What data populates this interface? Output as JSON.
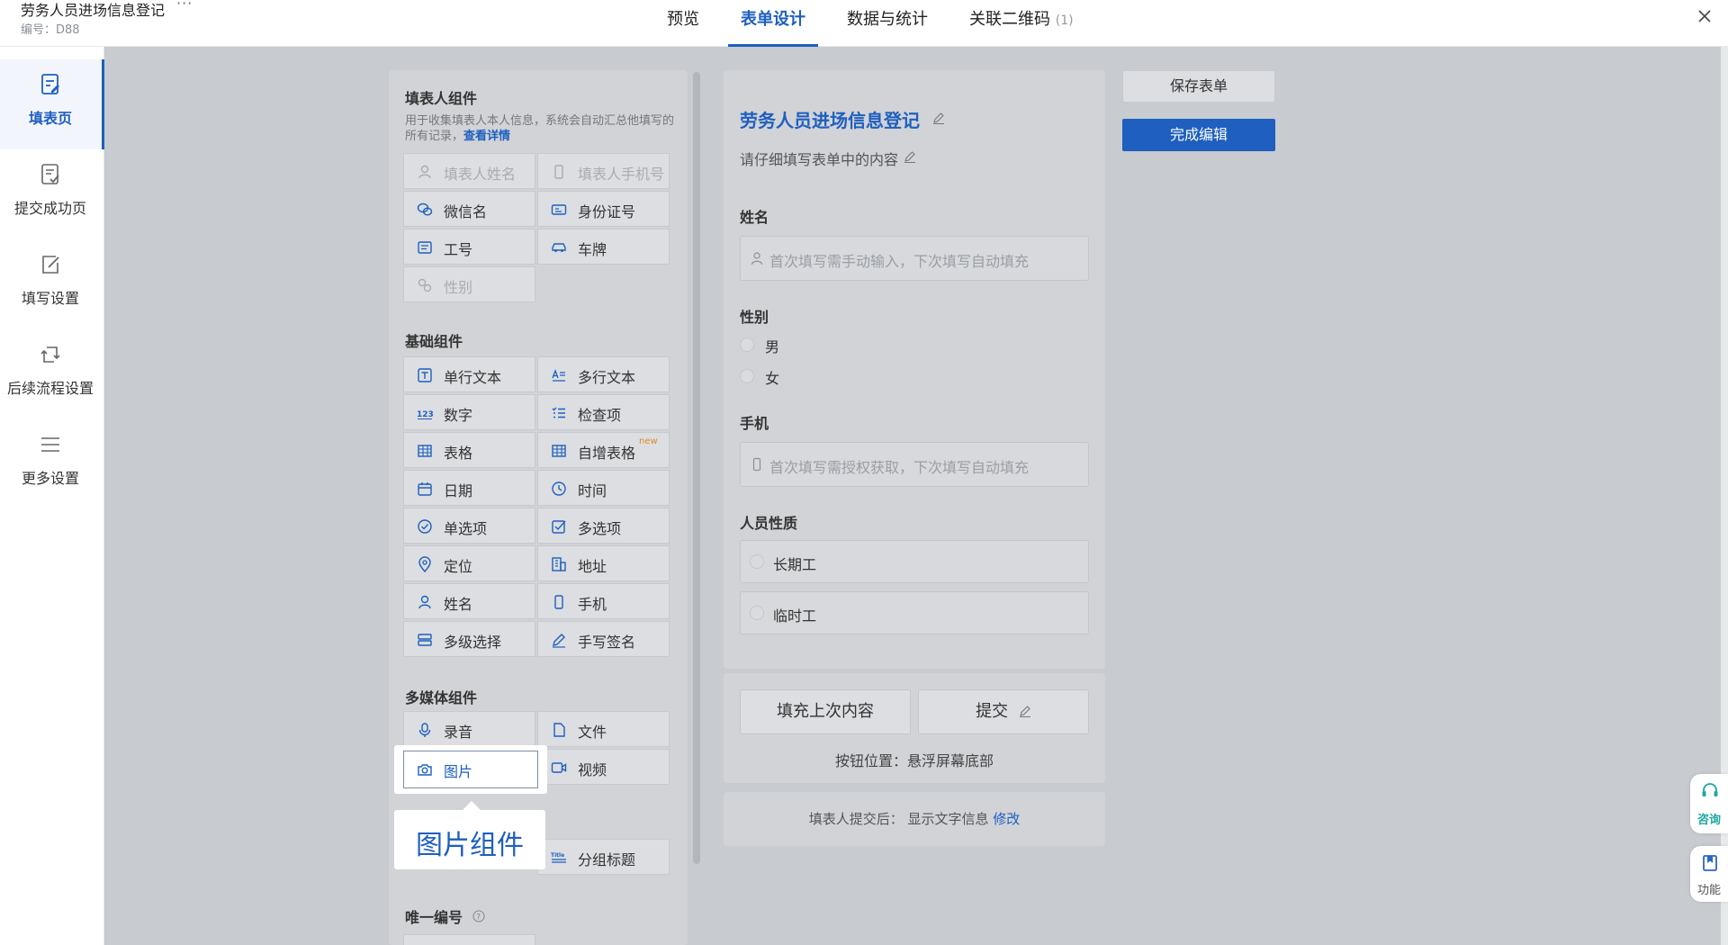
{
  "header": {
    "title": "劳务人员进场信息登记",
    "more": "···",
    "code": "编号：D88",
    "tabs": [
      {
        "label": "预览"
      },
      {
        "label": "表单设计"
      },
      {
        "label": "数据与统计"
      },
      {
        "label": "关联二维码",
        "count": "(1)"
      }
    ]
  },
  "sidebar": {
    "items": [
      {
        "label": "填表页",
        "icon": "form-page-icon"
      },
      {
        "label": "提交成功页",
        "icon": "submit-success-icon"
      },
      {
        "label": "填写设置",
        "icon": "fill-settings-icon"
      },
      {
        "label": "后续流程设置",
        "icon": "workflow-icon"
      },
      {
        "label": "更多设置",
        "icon": "menu-icon"
      }
    ]
  },
  "components": {
    "filler": {
      "title": "填表人组件",
      "desc": "用于收集填表人本人信息，系统会自动汇总他填写的所有记录，",
      "link": "查看详情",
      "items": [
        "填表人姓名",
        "填表人手机号",
        "微信名",
        "身份证号",
        "工号",
        "车牌",
        "性别"
      ]
    },
    "basic": {
      "title": "基础组件",
      "items": [
        "单行文本",
        "多行文本",
        "数字",
        "检查项",
        "表格",
        "自增表格",
        "日期",
        "时间",
        "单选项",
        "多选项",
        "定位",
        "地址",
        "姓名",
        "手机",
        "多级选择",
        "手写签名"
      ],
      "new_badge": "new"
    },
    "media": {
      "title": "多媒体组件",
      "items": [
        "录音",
        "文件",
        "图片",
        "视频"
      ],
      "extra": "分组标题"
    },
    "unique": {
      "title": "唯一编号"
    },
    "tooltip": "图片组件"
  },
  "form": {
    "title": "劳务人员进场信息登记",
    "desc": "请仔细填写表单中的内容",
    "fields": [
      {
        "label": "姓名",
        "placeholder": "首次填写需手动输入，下次填写自动填充"
      },
      {
        "label": "性别",
        "options": [
          "男",
          "女"
        ]
      },
      {
        "label": "手机",
        "placeholder": "首次填写需授权获取，下次填写自动填充"
      },
      {
        "label": "人员性质",
        "options": [
          "长期工",
          "临时工"
        ]
      }
    ],
    "buttons": {
      "fill_last": "填充上次内容",
      "submit": "提交"
    },
    "button_position": "按钮位置：悬浮屏幕底部",
    "after_submit": {
      "text": "填表人提交后： 显示文字信息",
      "link": "修改"
    }
  },
  "actions": {
    "save": "保存表单",
    "done": "完成编辑"
  },
  "float": {
    "consult": "咨询",
    "function": "功能"
  },
  "colors": {
    "accent": "#1e5fbf",
    "canvas": "#c8cbd0",
    "new_badge": "#e08a2c"
  }
}
